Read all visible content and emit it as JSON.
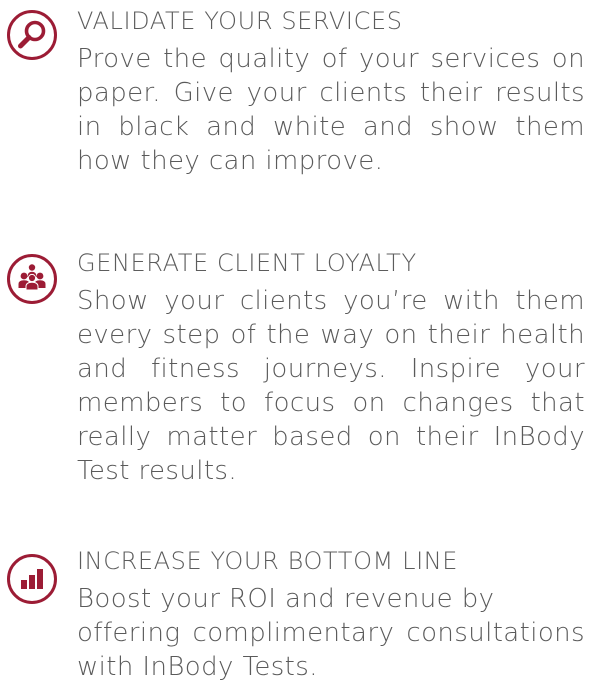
{
  "colors": {
    "accent": "#9c1c35",
    "text": "#5c5c5c"
  },
  "features": [
    {
      "icon": "magnifier-icon",
      "title": "VALIDATE YOUR SERVICES",
      "lines": [
        "Prove the quality of your services on",
        "paper. Give your clients their results",
        "in black and white and show them",
        "how they can improve."
      ]
    },
    {
      "icon": "people-group-icon",
      "title": "GENERATE CLIENT LOYALTY",
      "lines": [
        "Show your clients you’re with them",
        "every step of the way on their health",
        "and fitness journeys. Inspire your",
        "members to focus on changes that",
        "really matter based on their InBody",
        "Test results."
      ]
    },
    {
      "icon": "bar-chart-icon",
      "title": "INCREASE YOUR BOTTOM LINE",
      "lines": [
        "Boost your ROI and revenue by",
        "offering complimentary consultations",
        "with InBody Tests."
      ]
    }
  ]
}
